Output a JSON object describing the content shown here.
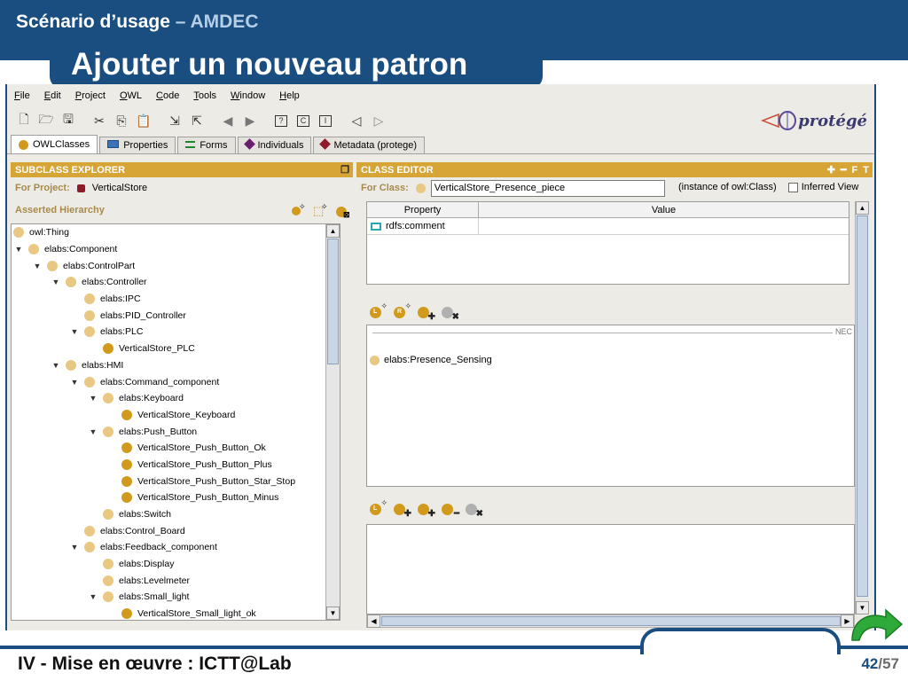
{
  "slide": {
    "crumb_main": "Scénario d’usage",
    "crumb_sep": " – ",
    "crumb_section": "AMDEC",
    "title": "Ajouter un nouveau patron",
    "footer": "IV - Mise en œuvre : ICTT@Lab",
    "page": "42",
    "page_total": "/57"
  },
  "menu": [
    {
      "label": "File",
      "key": "F"
    },
    {
      "label": "Edit",
      "key": "E"
    },
    {
      "label": "Project",
      "key": "P"
    },
    {
      "label": "OWL",
      "key": "O"
    },
    {
      "label": "Code",
      "key": "C"
    },
    {
      "label": "Tools",
      "key": "T"
    },
    {
      "label": "Window",
      "key": "W"
    },
    {
      "label": "Help",
      "key": "H"
    }
  ],
  "toolbar": {
    "icons": [
      "new-file-icon",
      "open-folder-icon",
      "save-icon",
      "cut-icon",
      "copy-icon",
      "paste-icon",
      "import-icon",
      "export-icon",
      "undo-icon",
      "redo-icon",
      "box-query-icon",
      "box-class-icon",
      "box-instance-icon",
      "back-icon",
      "forward-icon"
    ],
    "logo_text": "protégé"
  },
  "tabs": [
    {
      "label": "OWLClasses",
      "icon": "class-dot-icon",
      "active": true
    },
    {
      "label": "Properties",
      "icon": "properties-icon",
      "active": false
    },
    {
      "label": "Forms",
      "icon": "forms-icon",
      "active": false
    },
    {
      "label": "Individuals",
      "icon": "individuals-icon",
      "active": false
    },
    {
      "label": "Metadata (protege)",
      "icon": "metadata-icon",
      "active": false
    }
  ],
  "subclass_explorer": {
    "title": "SUBCLASS EXPLORER",
    "for_project_label": "For Project:",
    "project": "VerticalStore",
    "hierarchy_label": "Asserted Hierarchy",
    "tree": [
      {
        "label": "owl:Thing",
        "level": 0,
        "toggle": "",
        "kind": "class"
      },
      {
        "label": "elabs:Component",
        "level": 0,
        "toggle": "▼",
        "kind": "class"
      },
      {
        "label": "elabs:ControlPart",
        "level": 1,
        "toggle": "▼",
        "kind": "class"
      },
      {
        "label": "elabs:Controller",
        "level": 2,
        "toggle": "▼",
        "kind": "class"
      },
      {
        "label": "elabs:IPC",
        "level": 3,
        "toggle": "",
        "kind": "class"
      },
      {
        "label": "elabs:PID_Controller",
        "level": 3,
        "toggle": "",
        "kind": "class"
      },
      {
        "label": "elabs:PLC",
        "level": 3,
        "toggle": "▼",
        "kind": "class"
      },
      {
        "label": "VerticalStore_PLC",
        "level": 4,
        "toggle": "",
        "kind": "defined"
      },
      {
        "label": "elabs:HMI",
        "level": 2,
        "toggle": "▼",
        "kind": "class"
      },
      {
        "label": "elabs:Command_component",
        "level": 3,
        "toggle": "▼",
        "kind": "class"
      },
      {
        "label": "elabs:Keyboard",
        "level": 4,
        "toggle": "▼",
        "kind": "class"
      },
      {
        "label": "VerticalStore_Keyboard",
        "level": 5,
        "toggle": "",
        "kind": "defined"
      },
      {
        "label": "elabs:Push_Button",
        "level": 4,
        "toggle": "▼",
        "kind": "class"
      },
      {
        "label": "VerticalStore_Push_Button_Ok",
        "level": 5,
        "toggle": "",
        "kind": "defined"
      },
      {
        "label": "VerticalStore_Push_Button_Plus",
        "level": 5,
        "toggle": "",
        "kind": "defined"
      },
      {
        "label": "VerticalStore_Push_Button_Star_Stop",
        "level": 5,
        "toggle": "",
        "kind": "defined"
      },
      {
        "label": "VerticalStore_Push_Button_Minus",
        "level": 5,
        "toggle": "",
        "kind": "defined"
      },
      {
        "label": "elabs:Switch",
        "level": 4,
        "toggle": "",
        "kind": "class"
      },
      {
        "label": "elabs:Control_Board",
        "level": 3,
        "toggle": "",
        "kind": "class"
      },
      {
        "label": "elabs:Feedback_component",
        "level": 3,
        "toggle": "▼",
        "kind": "class"
      },
      {
        "label": "elabs:Display",
        "level": 4,
        "toggle": "",
        "kind": "class"
      },
      {
        "label": "elabs:Levelmeter",
        "level": 4,
        "toggle": "",
        "kind": "class"
      },
      {
        "label": "elabs:Small_light",
        "level": 4,
        "toggle": "▼",
        "kind": "class"
      },
      {
        "label": "VerticalStore_Small_light_ok",
        "level": 5,
        "toggle": "",
        "kind": "defined"
      }
    ]
  },
  "class_editor": {
    "title": "CLASS EDITOR",
    "for_class_label": "For Class:",
    "class_name": "VerticalStore_Presence_piece",
    "instance_of": "(instance of owl:Class)",
    "inferred_view": "Inferred View",
    "columns": [
      "Property",
      "Value"
    ],
    "rows": [
      {
        "property": "rdfs:comment",
        "value": ""
      }
    ],
    "necessary_label": "NEC",
    "necessary_items": [
      "elabs:Presence_Sensing"
    ]
  },
  "colors": {
    "slide_blue": "#1a4e80",
    "panel_header": "#d7a436",
    "class_dot": "#e8c882",
    "defined_dot": "#d29a1c",
    "arrow_green": "#2eaa3a"
  }
}
